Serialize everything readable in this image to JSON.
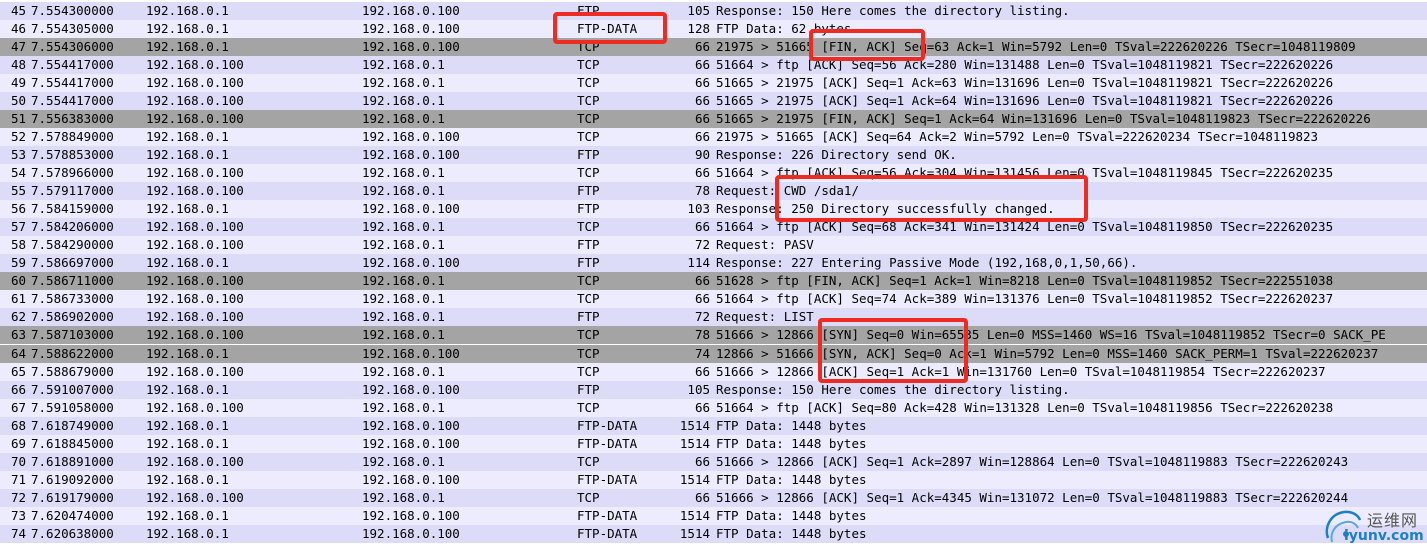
{
  "packets": [
    {
      "no": "45",
      "time": "7.554300000",
      "src": "192.168.0.1",
      "dst": "192.168.0.100",
      "proto": "FTP",
      "len": "105",
      "info": "Response: 150 Here comes the directory listing."
    },
    {
      "no": "46",
      "time": "7.554305000",
      "src": "192.168.0.1",
      "dst": "192.168.0.100",
      "proto": "FTP-DATA",
      "len": "128",
      "info": "FTP Data: 62 bytes"
    },
    {
      "no": "47",
      "time": "7.554306000",
      "src": "192.168.0.1",
      "dst": "192.168.0.100",
      "proto": "TCP",
      "len": "66",
      "info": "21975 > 51665 [FIN, ACK] Seq=63 Ack=1 Win=5792 Len=0 TSval=222620226 TSecr=1048119809"
    },
    {
      "no": "48",
      "time": "7.554417000",
      "src": "192.168.0.100",
      "dst": "192.168.0.1",
      "proto": "TCP",
      "len": "66",
      "info": "51664 > ftp [ACK] Seq=56 Ack=280 Win=131488 Len=0 TSval=1048119821 TSecr=222620226"
    },
    {
      "no": "49",
      "time": "7.554417000",
      "src": "192.168.0.100",
      "dst": "192.168.0.1",
      "proto": "TCP",
      "len": "66",
      "info": "51665 > 21975 [ACK] Seq=1 Ack=63 Win=131696 Len=0 TSval=1048119821 TSecr=222620226"
    },
    {
      "no": "50",
      "time": "7.554417000",
      "src": "192.168.0.100",
      "dst": "192.168.0.1",
      "proto": "TCP",
      "len": "66",
      "info": "51665 > 21975 [ACK] Seq=1 Ack=64 Win=131696 Len=0 TSval=1048119821 TSecr=222620226"
    },
    {
      "no": "51",
      "time": "7.556383000",
      "src": "192.168.0.100",
      "dst": "192.168.0.1",
      "proto": "TCP",
      "len": "66",
      "info": "51665 > 21975 [FIN, ACK] Seq=1 Ack=64 Win=131696 Len=0 TSval=1048119823 TSecr=222620226"
    },
    {
      "no": "52",
      "time": "7.578849000",
      "src": "192.168.0.1",
      "dst": "192.168.0.100",
      "proto": "TCP",
      "len": "66",
      "info": "21975 > 51665 [ACK] Seq=64 Ack=2 Win=5792 Len=0 TSval=222620234 TSecr=1048119823"
    },
    {
      "no": "53",
      "time": "7.578853000",
      "src": "192.168.0.1",
      "dst": "192.168.0.100",
      "proto": "FTP",
      "len": "90",
      "info": "Response: 226 Directory send OK."
    },
    {
      "no": "54",
      "time": "7.578966000",
      "src": "192.168.0.100",
      "dst": "192.168.0.1",
      "proto": "TCP",
      "len": "66",
      "info": "51664 > ftp [ACK] Seq=56 Ack=304 Win=131456 Len=0 TSval=1048119845 TSecr=222620235"
    },
    {
      "no": "55",
      "time": "7.579117000",
      "src": "192.168.0.100",
      "dst": "192.168.0.1",
      "proto": "FTP",
      "len": "78",
      "info": "Request: CWD /sda1/"
    },
    {
      "no": "56",
      "time": "7.584159000",
      "src": "192.168.0.1",
      "dst": "192.168.0.100",
      "proto": "FTP",
      "len": "103",
      "info": "Response: 250 Directory successfully changed."
    },
    {
      "no": "57",
      "time": "7.584206000",
      "src": "192.168.0.100",
      "dst": "192.168.0.1",
      "proto": "TCP",
      "len": "66",
      "info": "51664 > ftp [ACK] Seq=68 Ack=341 Win=131424 Len=0 TSval=1048119850 TSecr=222620235"
    },
    {
      "no": "58",
      "time": "7.584290000",
      "src": "192.168.0.100",
      "dst": "192.168.0.1",
      "proto": "FTP",
      "len": "72",
      "info": "Request: PASV"
    },
    {
      "no": "59",
      "time": "7.586697000",
      "src": "192.168.0.1",
      "dst": "192.168.0.100",
      "proto": "FTP",
      "len": "114",
      "info": "Response: 227 Entering Passive Mode (192,168,0,1,50,66)."
    },
    {
      "no": "60",
      "time": "7.586711000",
      "src": "192.168.0.100",
      "dst": "192.168.0.1",
      "proto": "TCP",
      "len": "66",
      "info": "51628 > ftp [FIN, ACK] Seq=1 Ack=1 Win=8218 Len=0 TSval=1048119852 TSecr=222551038"
    },
    {
      "no": "61",
      "time": "7.586733000",
      "src": "192.168.0.100",
      "dst": "192.168.0.1",
      "proto": "TCP",
      "len": "66",
      "info": "51664 > ftp [ACK] Seq=74 Ack=389 Win=131376 Len=0 TSval=1048119852 TSecr=222620237"
    },
    {
      "no": "62",
      "time": "7.586902000",
      "src": "192.168.0.100",
      "dst": "192.168.0.1",
      "proto": "FTP",
      "len": "72",
      "info": "Request: LIST"
    },
    {
      "no": "63",
      "time": "7.587103000",
      "src": "192.168.0.100",
      "dst": "192.168.0.1",
      "proto": "TCP",
      "len": "78",
      "info": "51666 > 12866 [SYN] Seq=0 Win=65535 Len=0 MSS=1460 WS=16 TSval=1048119852 TSecr=0 SACK_PE"
    },
    {
      "no": "64",
      "time": "7.588622000",
      "src": "192.168.0.1",
      "dst": "192.168.0.100",
      "proto": "TCP",
      "len": "74",
      "info": "12866 > 51666 [SYN, ACK] Seq=0 Ack=1 Win=5792 Len=0 MSS=1460 SACK_PERM=1 TSval=222620237"
    },
    {
      "no": "65",
      "time": "7.588679000",
      "src": "192.168.0.100",
      "dst": "192.168.0.1",
      "proto": "TCP",
      "len": "66",
      "info": "51666 > 12866 [ACK] Seq=1 Ack=1 Win=131760 Len=0 TSval=1048119854 TSecr=222620237"
    },
    {
      "no": "66",
      "time": "7.591007000",
      "src": "192.168.0.1",
      "dst": "192.168.0.100",
      "proto": "FTP",
      "len": "105",
      "info": "Response: 150 Here comes the directory listing."
    },
    {
      "no": "67",
      "time": "7.591058000",
      "src": "192.168.0.100",
      "dst": "192.168.0.1",
      "proto": "TCP",
      "len": "66",
      "info": "51664 > ftp [ACK] Seq=80 Ack=428 Win=131328 Len=0 TSval=1048119856 TSecr=222620238"
    },
    {
      "no": "68",
      "time": "7.618749000",
      "src": "192.168.0.1",
      "dst": "192.168.0.100",
      "proto": "FTP-DATA",
      "len": "1514",
      "info": "FTP Data: 1448 bytes"
    },
    {
      "no": "69",
      "time": "7.618845000",
      "src": "192.168.0.1",
      "dst": "192.168.0.100",
      "proto": "FTP-DATA",
      "len": "1514",
      "info": "FTP Data: 1448 bytes"
    },
    {
      "no": "70",
      "time": "7.618891000",
      "src": "192.168.0.100",
      "dst": "192.168.0.1",
      "proto": "TCP",
      "len": "66",
      "info": "51666 > 12866 [ACK] Seq=1 Ack=2897 Win=128864 Len=0 TSval=1048119883 TSecr=222620243"
    },
    {
      "no": "71",
      "time": "7.619092000",
      "src": "192.168.0.1",
      "dst": "192.168.0.100",
      "proto": "FTP-DATA",
      "len": "1514",
      "info": "FTP Data: 1448 bytes"
    },
    {
      "no": "72",
      "time": "7.619179000",
      "src": "192.168.0.100",
      "dst": "192.168.0.1",
      "proto": "TCP",
      "len": "66",
      "info": "51666 > 12866 [ACK] Seq=1 Ack=4345 Win=131072 Len=0 TSval=1048119883 TSecr=222620244"
    },
    {
      "no": "73",
      "time": "7.620474000",
      "src": "192.168.0.1",
      "dst": "192.168.0.100",
      "proto": "FTP-DATA",
      "len": "1514",
      "info": "FTP Data: 1448 bytes"
    },
    {
      "no": "74",
      "time": "7.620638000",
      "src": "192.168.0.1",
      "dst": "192.168.0.100",
      "proto": "FTP-DATA",
      "len": "1514",
      "info": "FTP Data: 1448 bytes"
    }
  ],
  "row_styles": [
    "c0",
    "c1",
    "c2",
    "c0",
    "c1",
    "c0",
    "c2",
    "c1",
    "c0",
    "c1",
    "c0",
    "c1",
    "c0",
    "c1",
    "c0",
    "c2",
    "c1",
    "c0",
    "c2",
    "c2",
    "c1",
    "c0",
    "c1",
    "c0",
    "c1",
    "c0",
    "c1",
    "c0",
    "c1",
    "c0"
  ],
  "colors": {
    "highlight_box": "#ee2b22",
    "row_lavender": "#dcdcf8",
    "row_light": "#ececfe",
    "row_gray": "#a4a4a4",
    "watermark_blue": "#1e7fc8"
  },
  "watermark": {
    "icon": "cloud-logo-icon",
    "text": "运维网",
    "url": "iyunv.com"
  }
}
